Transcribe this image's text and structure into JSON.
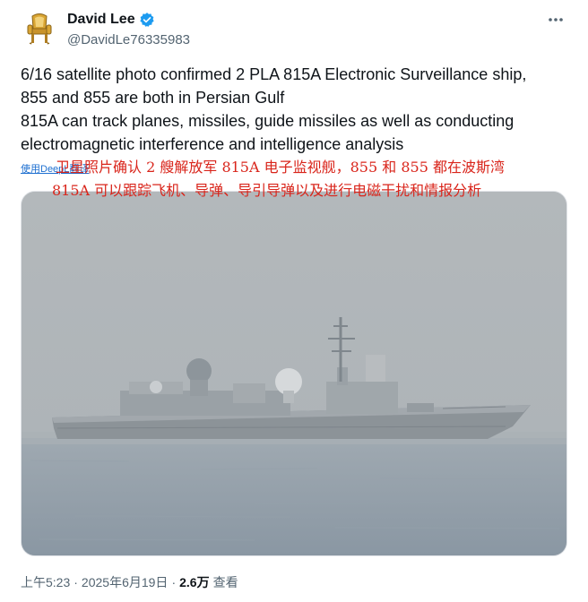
{
  "author": {
    "display_name": "David Lee",
    "handle": "@DavidLe76335983",
    "verified": true,
    "avatar_icon": "golden-throne-chair-icon"
  },
  "tweet": {
    "lines": [
      "6/16 satellite photo confirmed 2 PLA 815A Electronic Surveillance ship,",
      "855 and 855 are both in Persian Gulf",
      "815A can track planes, missiles, guide missiles as well as conducting",
      "electromagnetic interference and intelligence analysis"
    ]
  },
  "translation": {
    "link_label": "使用DeepL翻译",
    "lines": [
      "卫星照片确认 2 艘解放军 815A 电子监视舰，855 和 855 都在波斯湾",
      "815A 可以跟踪飞机、导弹、导引导弹以及进行电磁干扰和情报分析"
    ]
  },
  "meta": {
    "time": "上午5:23",
    "separator1": "·",
    "date": "2025年6月19日",
    "separator2": "·",
    "views_count": "2.6万",
    "views_label": "查看"
  },
  "icons": {
    "more": "more-options-icon",
    "verified": "verified-badge-icon"
  },
  "colors": {
    "verified_blue": "#1d9bf0",
    "translation_red": "#d9251b",
    "secondary_text": "#536471"
  }
}
